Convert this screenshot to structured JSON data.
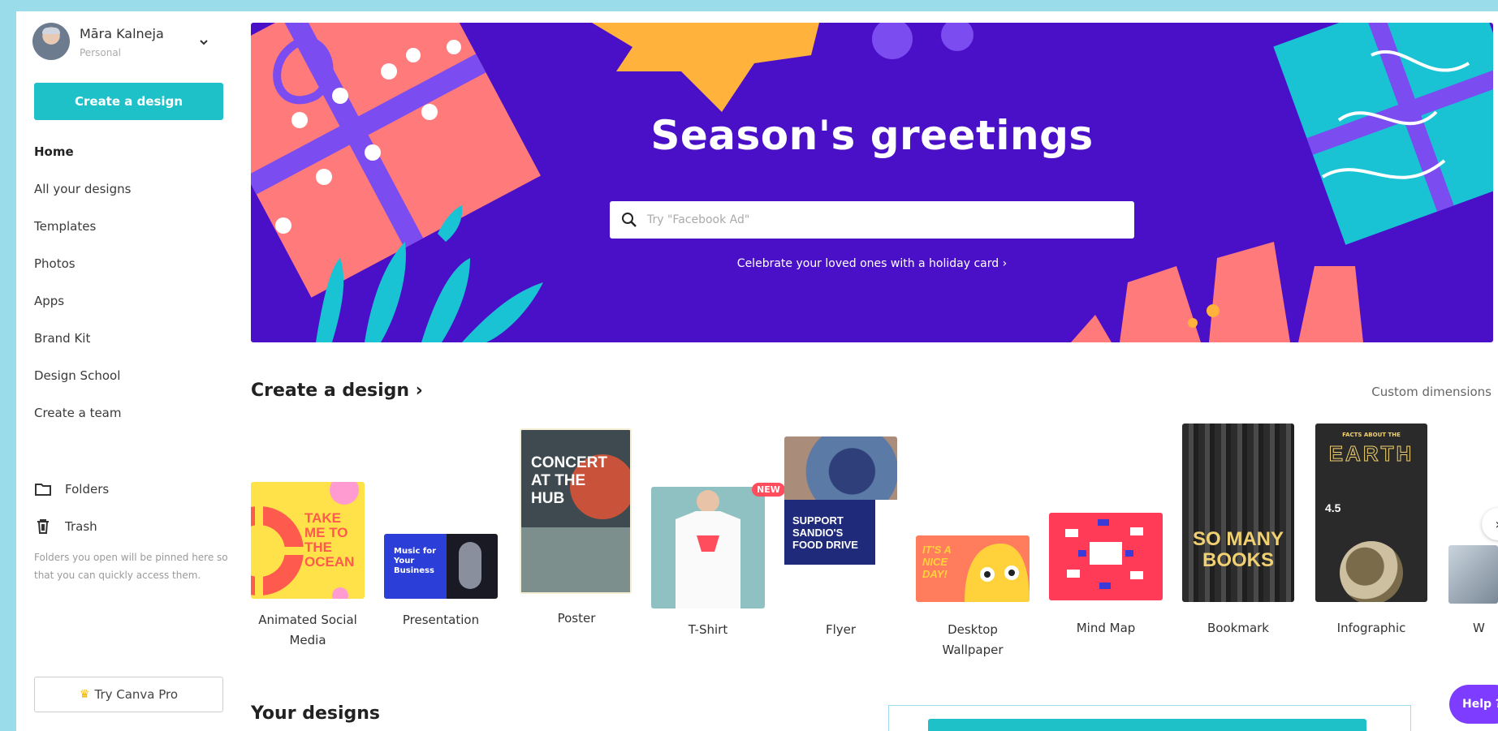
{
  "user": {
    "name": "Māra Kalneja",
    "plan": "Personal"
  },
  "sidebar": {
    "create_label": "Create a design",
    "nav": [
      {
        "label": "Home",
        "active": true
      },
      {
        "label": "All your designs"
      },
      {
        "label": "Templates"
      },
      {
        "label": "Photos"
      },
      {
        "label": "Apps"
      },
      {
        "label": "Brand Kit"
      },
      {
        "label": "Design School"
      },
      {
        "label": "Create a team"
      }
    ],
    "folders_label": "Folders",
    "trash_label": "Trash",
    "folder_note": "Folders you open will be pinned here so that you can quickly access them.",
    "try_pro_label": "Try Canva Pro"
  },
  "hero": {
    "title": "Season's greetings",
    "search_placeholder": "Try \"Facebook Ad\"",
    "link": "Celebrate your loved ones with a holiday card ›",
    "bg_color": "#4a10c8"
  },
  "create_section": {
    "title": "Create a design ›",
    "custom_dimensions": "Custom dimensions",
    "items": [
      {
        "label": "Animated Social Media",
        "thumb_text": "TAKE ME TO THE OCEAN"
      },
      {
        "label": "Presentation",
        "thumb_text": "Music for Your Business"
      },
      {
        "label": "Poster",
        "thumb_text": "CONCERT AT THE HUB"
      },
      {
        "label": "T-Shirt",
        "badge": "NEW"
      },
      {
        "label": "Flyer",
        "thumb_text": "SUPPORT SANDIO'S FOOD DRIVE"
      },
      {
        "label": "Desktop Wallpaper",
        "thumb_text": "IT'S A NICE DAY!"
      },
      {
        "label": "Mind Map"
      },
      {
        "label": "Bookmark",
        "thumb_text": "SO MANY BOOKS"
      },
      {
        "label": "Infographic",
        "thumb_text_top": "FACTS ABOUT THE",
        "thumb_text": "EARTH",
        "stat": "4.5"
      },
      {
        "label": "W"
      }
    ]
  },
  "your_designs": {
    "title": "Your designs"
  },
  "help": {
    "label": "Help ?"
  },
  "colors": {
    "accent": "#1fc1c9",
    "help": "#7d3cff",
    "badge_new": "#ff4d5e"
  }
}
